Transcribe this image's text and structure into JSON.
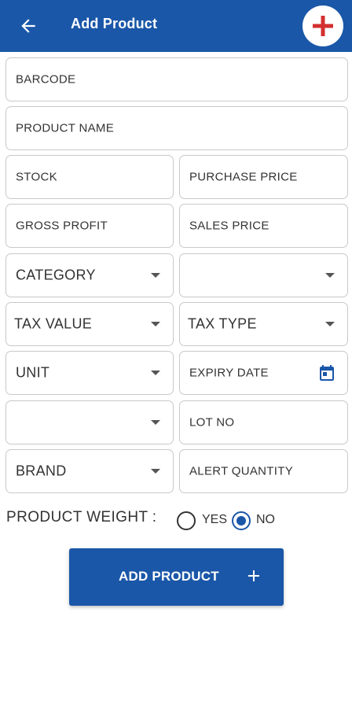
{
  "header": {
    "title": "Add Product",
    "back_icon": "arrow-left-icon",
    "add_icon": "plus-icon",
    "background": "#1a57a8",
    "add_icon_color": "#d32f2f"
  },
  "form": {
    "barcode": "BARCODE",
    "product_name": "PRODUCT NAME",
    "stock": "STOCK",
    "purchase_price": "PURCHASE PRICE",
    "gross_profit": "GROSS PROFIT",
    "sales_price": "SALES PRICE",
    "category": "CATEGORY",
    "subcategory": "",
    "tax_value": "TAX VALUE",
    "tax_type": "TAX TYPE",
    "unit": "UNIT",
    "expiry_date": "EXPIRY DATE",
    "unlabeled_select": "",
    "lot_no": "LOT NO",
    "brand": "BRAND",
    "alert_quantity": "ALERT QUANTITY"
  },
  "product_weight": {
    "label": "PRODUCT WEIGHT :",
    "options": [
      "YES",
      "NO"
    ],
    "selected": "NO"
  },
  "submit": {
    "label": "ADD PRODUCT",
    "icon": "plus-icon"
  },
  "colors": {
    "primary": "#1a57a8",
    "field_border": "#c9c9c9"
  }
}
